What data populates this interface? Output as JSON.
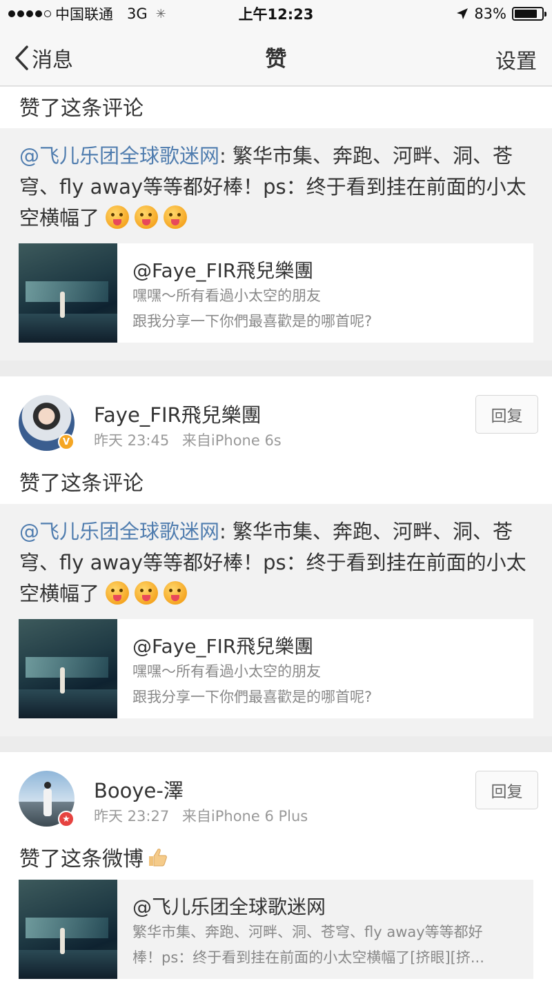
{
  "status_bar": {
    "carrier": "中国联通",
    "network": "3G",
    "time": "上午12:23",
    "battery": "83%",
    "battery_level": 0.83
  },
  "nav": {
    "back_label": "消息",
    "title": "赞",
    "settings_label": "设置"
  },
  "items": [
    {
      "action": "赞了这条评论",
      "quote": {
        "mention": "@飞儿乐团全球歌迷网",
        "text": ": 繁华市集、奔跑、河畔、洞、苍穹、fly away等等都好棒！ps：终于看到挂在前面的小太空横幅了"
      },
      "link": {
        "title": "@Faye_FIR飛兒樂團",
        "line1": "嘿嘿～所有看過小太空的朋友",
        "line2": "跟我分享一下你們最喜歡是的哪首呢?"
      }
    },
    {
      "user": "Faye_FIR飛兒樂團",
      "time": "昨天 23:45",
      "source": "来自iPhone 6s",
      "reply_label": "回复",
      "action": "赞了这条评论",
      "quote": {
        "mention": "@飞儿乐团全球歌迷网",
        "text": ": 繁华市集、奔跑、河畔、洞、苍穹、fly away等等都好棒！ps：终于看到挂在前面的小太空横幅了"
      },
      "link": {
        "title": "@Faye_FIR飛兒樂團",
        "line1": "嘿嘿～所有看過小太空的朋友",
        "line2": "跟我分享一下你們最喜歡是的哪首呢?"
      }
    },
    {
      "user": "Booye-澤",
      "time": "昨天 23:27",
      "source": "来自iPhone 6 Plus",
      "reply_label": "回复",
      "action": "赞了这条微博",
      "link": {
        "title": "@飞儿乐团全球歌迷网",
        "line1": "繁华市集、奔跑、河畔、洞、苍穹、fly away等等都好",
        "line2": "棒！ps：终于看到挂在前面的小太空横幅了[挤眼][挤..."
      }
    }
  ]
}
